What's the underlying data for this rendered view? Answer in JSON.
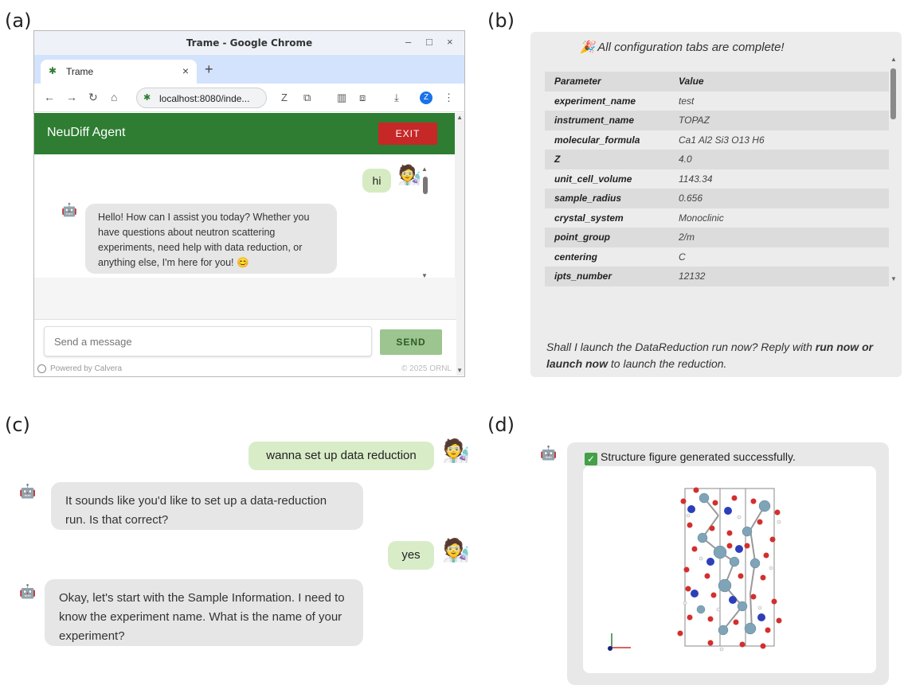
{
  "panels": {
    "a": "(a)",
    "b": "(b)",
    "c": "(c)",
    "d": "(d)"
  },
  "browser": {
    "window_title": "Trame - Google Chrome",
    "window_controls": {
      "minimize": "–",
      "maximize": "□",
      "close": "×"
    },
    "tab_title": "Trame",
    "tab_close": "×",
    "new_tab": "+",
    "url": "localhost:8080/inde...",
    "profile_initial": "Z"
  },
  "app": {
    "title": "NeuDiff Agent",
    "exit_label": "EXIT",
    "user_message": "hi",
    "bot_message": "Hello! How can I assist you today? Whether you have questions about neutron scattering experiments, need help with data reduction, or anything else, I'm here for you! 😊",
    "input_placeholder": "Send a message",
    "send_label": "SEND",
    "footer_left": "Powered by Calvera",
    "footer_right": "© 2025 ORNL"
  },
  "config": {
    "complete_msg": "🎉 All configuration tabs are complete!",
    "header": {
      "parameter": "Parameter",
      "value": "Value"
    },
    "rows": [
      {
        "param": "experiment_name",
        "value": "test"
      },
      {
        "param": "instrument_name",
        "value": "TOPAZ"
      },
      {
        "param": "molecular_formula",
        "value": "Ca1 Al2 Si3 O13 H6"
      },
      {
        "param": "Z",
        "value": "4.0"
      },
      {
        "param": "unit_cell_volume",
        "value": "1143.34"
      },
      {
        "param": "sample_radius",
        "value": "0.656"
      },
      {
        "param": "crystal_system",
        "value": "Monoclinic"
      },
      {
        "param": "point_group",
        "value": "2/m"
      },
      {
        "param": "centering",
        "value": "C"
      },
      {
        "param": "ipts_number",
        "value": "12132"
      }
    ],
    "question_prefix": "Shall I launch the DataReduction run now? Reply with ",
    "question_bold": "run now or launch now",
    "question_suffix": " to launch the reduction."
  },
  "chat_c": {
    "user_1": "wanna set up data reduction",
    "bot_1": "It sounds like you'd like to set up a data-reduction run. Is that correct?",
    "user_2": "yes",
    "bot_2": "Okay, let's start with the Sample Information. I need to know the experiment name. What is the name of your experiment?"
  },
  "structure": {
    "message": "Structure figure generated successfully."
  },
  "colors": {
    "green": "#2e7d32",
    "exit_red": "#c62828",
    "user_bubble": "#d9ecc8",
    "bot_bubble": "#e6e6e6"
  }
}
